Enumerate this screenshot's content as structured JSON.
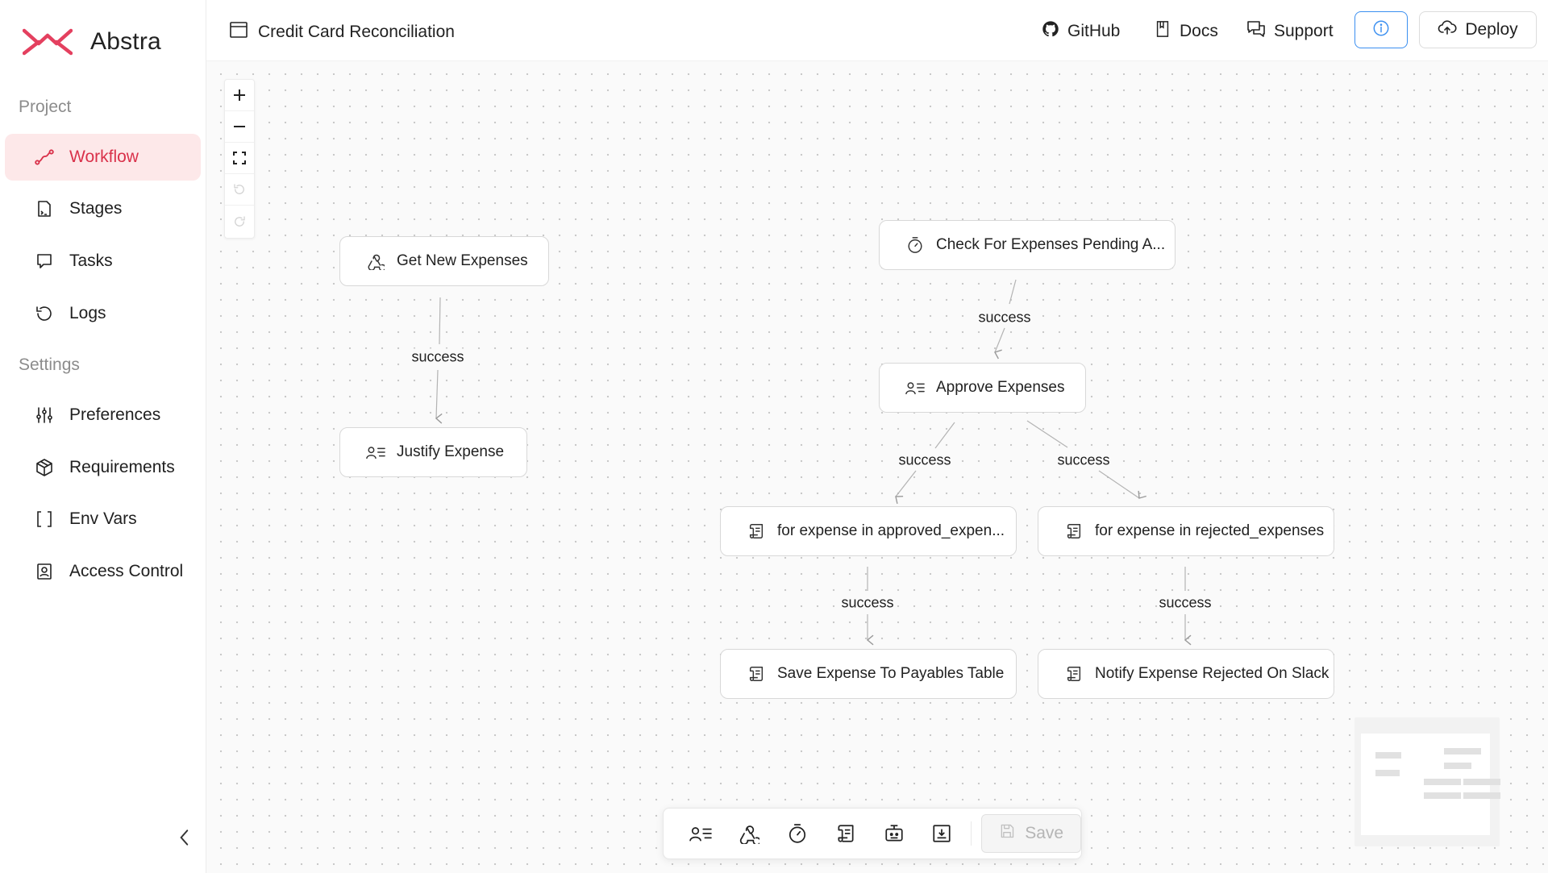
{
  "app": {
    "name": "Abstra",
    "brand_color": "#e4405f"
  },
  "sidebar": {
    "project_title": "Project",
    "settings_title": "Settings",
    "project_items": [
      {
        "label": "Workflow",
        "icon": "workflow-icon",
        "active": true
      },
      {
        "label": "Stages",
        "icon": "stages-icon"
      },
      {
        "label": "Tasks",
        "icon": "tasks-icon"
      },
      {
        "label": "Logs",
        "icon": "logs-icon"
      }
    ],
    "settings_items": [
      {
        "label": "Preferences",
        "icon": "sliders-icon"
      },
      {
        "label": "Requirements",
        "icon": "package-icon"
      },
      {
        "label": "Env Vars",
        "icon": "brackets-icon"
      },
      {
        "label": "Access Control",
        "icon": "badge-icon"
      }
    ]
  },
  "header": {
    "title": "Credit Card Reconciliation",
    "links": {
      "github": "GitHub",
      "docs": "Docs",
      "support": "Support"
    },
    "deploy_label": "Deploy",
    "info_color": "#3b8ff0"
  },
  "workflow": {
    "nodes": {
      "get_new_expenses": {
        "label": "Get New Expenses",
        "icon": "webhook-icon"
      },
      "justify_expense": {
        "label": "Justify Expense",
        "icon": "form-icon"
      },
      "check_pending": {
        "label": "Check For Expenses Pending A...",
        "icon": "timer-icon"
      },
      "approve_expenses": {
        "label": "Approve Expenses",
        "icon": "form-icon"
      },
      "loop_approved": {
        "label": "for expense in approved_expen...",
        "icon": "script-icon"
      },
      "loop_rejected": {
        "label": "for expense in rejected_expenses",
        "icon": "script-icon"
      },
      "save_payables": {
        "label": "Save Expense To Payables Table",
        "icon": "script-icon"
      },
      "notify_slack": {
        "label": "Notify Expense Rejected On Slack",
        "icon": "script-icon"
      }
    },
    "edges": [
      {
        "label": "success"
      },
      {
        "label": "success"
      },
      {
        "label": "success"
      },
      {
        "label": "success"
      },
      {
        "label": "success"
      },
      {
        "label": "success"
      }
    ]
  },
  "toolbar": {
    "save_label": "Save"
  }
}
